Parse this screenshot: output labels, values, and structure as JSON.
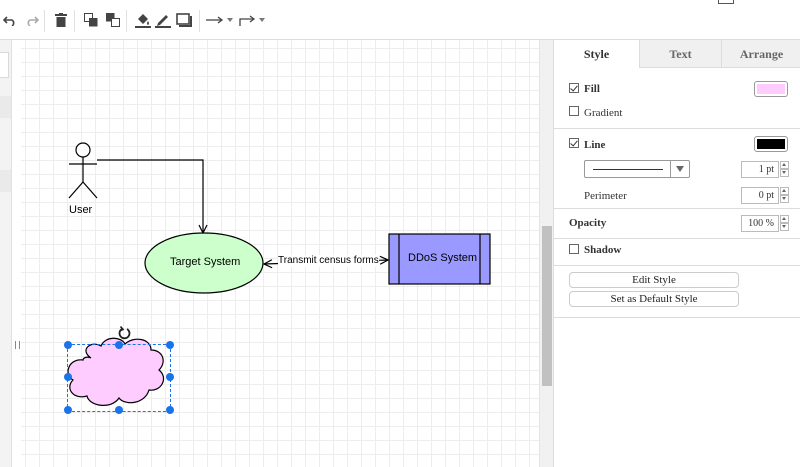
{
  "toolbar": {
    "icons": [
      "undo-icon",
      "redo-icon",
      "delete-icon",
      "to-front-icon",
      "to-back-icon",
      "fill-color-icon",
      "line-color-icon",
      "shadow-icon",
      "connection-icon",
      "waypoints-icon"
    ]
  },
  "diagram": {
    "actor_label": "User",
    "target_label": "Target System",
    "ddos_label": "DDoS System",
    "edge_label": "Transmit census forms",
    "colors": {
      "ellipse_fill": "#ccffcc",
      "process_fill": "#9999ff",
      "cloud_fill": "#ffccff",
      "selection": "#1a73e8"
    }
  },
  "panel": {
    "tabs": [
      {
        "label": "Style"
      },
      {
        "label": "Text"
      },
      {
        "label": "Arrange"
      }
    ],
    "fill_label": "Fill",
    "fill_checked": true,
    "fill_color": "#ffccff",
    "gradient_label": "Gradient",
    "gradient_checked": false,
    "line_label": "Line",
    "line_checked": true,
    "line_color": "#000000",
    "line_width": "1 pt",
    "perimeter_label": "Perimeter",
    "perimeter_value": "0 pt",
    "opacity_label": "Opacity",
    "opacity_value": "100 %",
    "shadow_label": "Shadow",
    "shadow_checked": false,
    "edit_style_label": "Edit Style",
    "default_style_label": "Set as Default Style"
  }
}
